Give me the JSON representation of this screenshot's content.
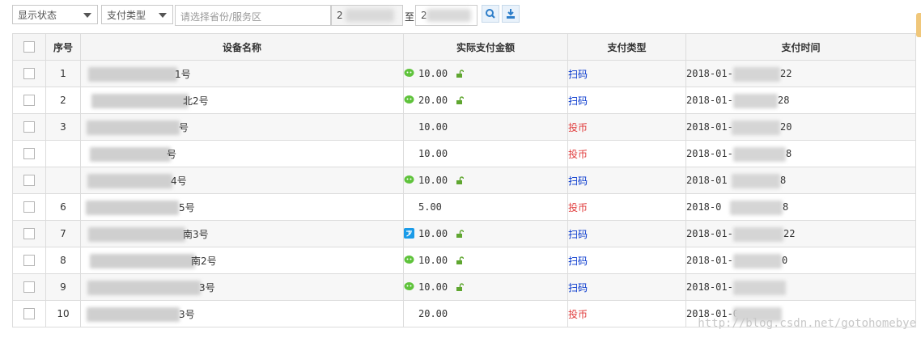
{
  "filters": {
    "status_select": "显示状态",
    "paytype_select": "支付类型",
    "region_placeholder": "请选择省份/服务区",
    "date_from": "2",
    "date_to_label": "至",
    "date_to": "2"
  },
  "table": {
    "headers": [
      "序号",
      "设备名称",
      "实际支付金额",
      "支付类型",
      "支付时间"
    ],
    "rows": [
      {
        "idx": "1",
        "name": "1号",
        "pay_icon": "wechat",
        "amount": "10.00",
        "lock": true,
        "type": "扫码",
        "type_kind": "scan",
        "time_start": "2018-01-",
        "time_end": "22"
      },
      {
        "idx": "2",
        "name": "北2号",
        "pay_icon": "wechat",
        "amount": "20.00",
        "lock": true,
        "type": "扫码",
        "type_kind": "scan",
        "time_start": "2018-01-",
        "time_end": "28"
      },
      {
        "idx": "3",
        "name": "号",
        "pay_icon": "",
        "amount": "10.00",
        "lock": false,
        "type": "投币",
        "type_kind": "coin",
        "time_start": "2018-01-",
        "time_end": "20"
      },
      {
        "idx": "",
        "name": "号",
        "pay_icon": "",
        "amount": "10.00",
        "lock": false,
        "type": "投币",
        "type_kind": "coin",
        "time_start": "2018-01-",
        "time_end": "8"
      },
      {
        "idx": "",
        "name": "4号",
        "pay_icon": "wechat",
        "amount": "10.00",
        "lock": true,
        "type": "扫码",
        "type_kind": "scan",
        "time_start": "2018-01",
        "time_end": "8"
      },
      {
        "idx": "6",
        "name": "5号",
        "pay_icon": "",
        "amount": "5.00",
        "lock": false,
        "type": "投币",
        "type_kind": "coin",
        "time_start": "2018-0",
        "time_end": "8"
      },
      {
        "idx": "7",
        "name": "南3号",
        "pay_icon": "alipay",
        "amount": "10.00",
        "lock": true,
        "type": "扫码",
        "type_kind": "scan",
        "time_start": "2018-01-",
        "time_end": "22"
      },
      {
        "idx": "8",
        "name": "南2号",
        "pay_icon": "wechat",
        "amount": "10.00",
        "lock": true,
        "type": "扫码",
        "type_kind": "scan",
        "time_start": "2018-01-",
        "time_end": "0"
      },
      {
        "idx": "9",
        "name": "3号",
        "pay_icon": "wechat",
        "amount": "10.00",
        "lock": true,
        "type": "扫码",
        "type_kind": "scan",
        "time_start": "2018-01-",
        "time_end": ""
      },
      {
        "idx": "10",
        "name": "3号",
        "pay_icon": "",
        "amount": "20.00",
        "lock": false,
        "type": "投币",
        "type_kind": "coin",
        "time_start": "2018-01-0",
        "time_end": ""
      }
    ]
  },
  "watermark": "http://blog.csdn.net/gotohomebye",
  "colors": {
    "scan": "#0033cc",
    "coin": "#e03c3c",
    "wechat": "#5fc33b",
    "alipay": "#1a9be8"
  }
}
